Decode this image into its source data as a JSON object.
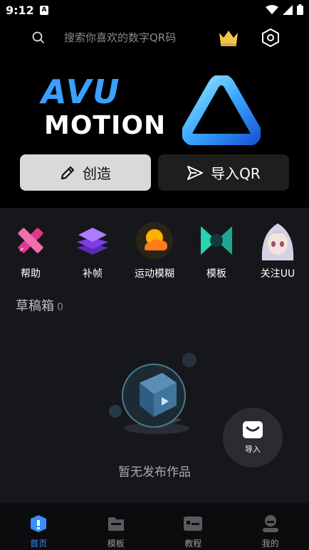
{
  "status_bar": {
    "time": "9:12",
    "app_icon": "A"
  },
  "search": {
    "placeholder": "搜索你喜欢的数字QR码"
  },
  "hero": {
    "line1": "AVU",
    "line2": "MOTION"
  },
  "actions": {
    "create_label": "创造",
    "import_qr_label": "导入QR"
  },
  "tools": [
    {
      "label": "帮助",
      "icon": "help-ruler-pencil-icon"
    },
    {
      "label": "补帧",
      "icon": "layers-icon"
    },
    {
      "label": "运动模糊",
      "icon": "sun-cloud-icon"
    },
    {
      "label": "模板",
      "icon": "bowtie-template-icon"
    },
    {
      "label": "关注UU",
      "icon": "anime-avatar-icon"
    }
  ],
  "drafts": {
    "title": "草稿箱",
    "count": "0",
    "empty_text": "暂无发布作品"
  },
  "fab": {
    "label": "导入"
  },
  "nav": [
    {
      "label": "首页",
      "icon": "home-icon",
      "active": true
    },
    {
      "label": "模板",
      "icon": "folder-icon",
      "active": false
    },
    {
      "label": "教程",
      "icon": "tutorial-icon",
      "active": false
    },
    {
      "label": "我的",
      "icon": "profile-icon",
      "active": false
    }
  ],
  "colors": {
    "accent": "#3a8dff",
    "panel_bg": "#16171b",
    "create_button_bg": "#d9d9d9"
  }
}
